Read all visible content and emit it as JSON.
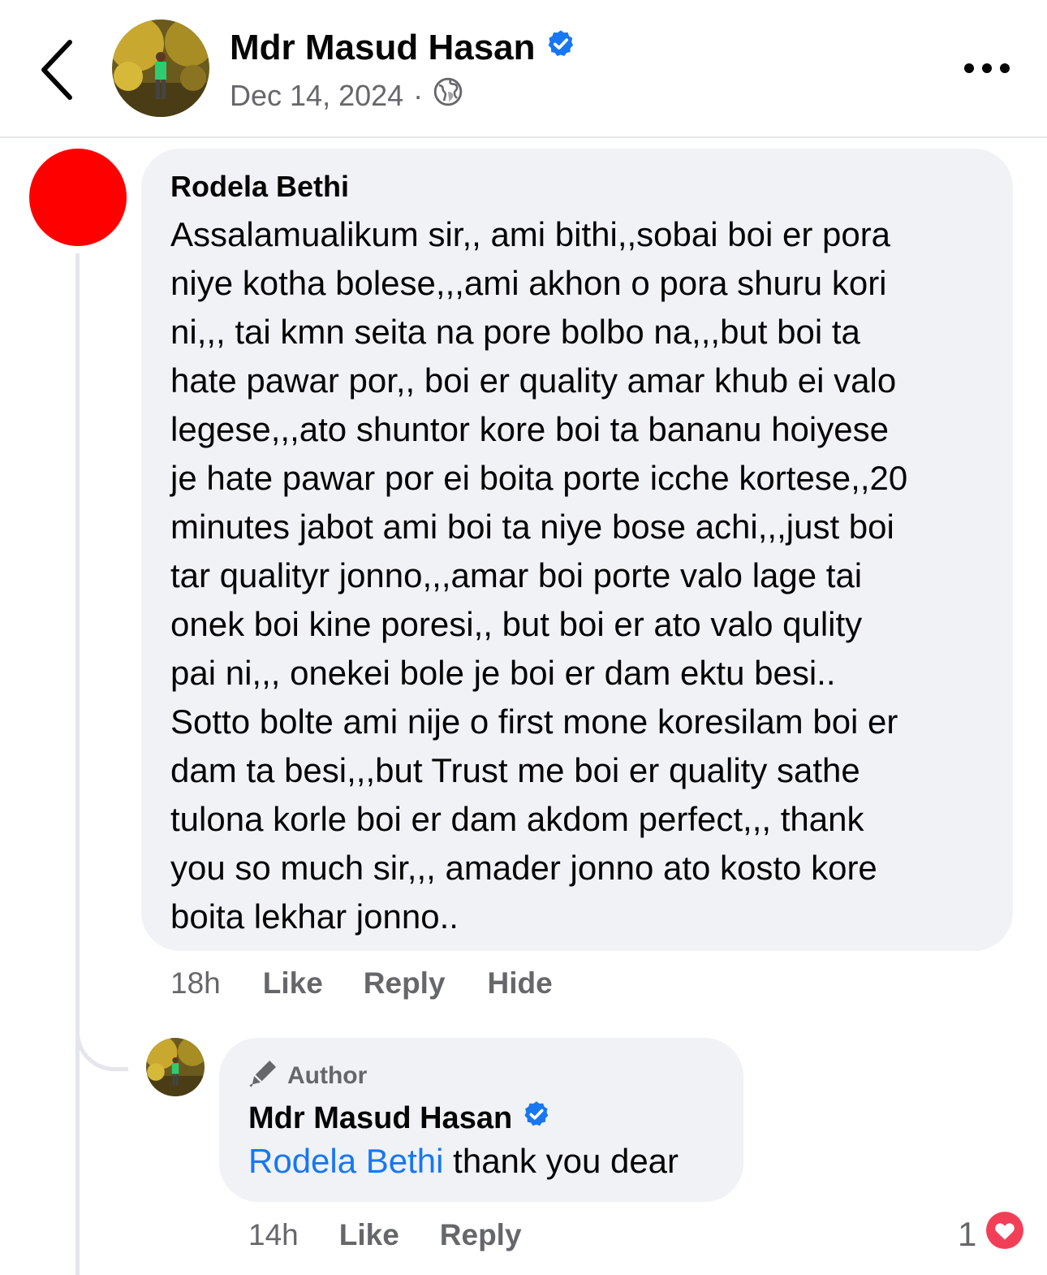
{
  "header": {
    "author_name": "Mdr Masud Hasan",
    "date": "Dec 14, 2024",
    "separator": "·",
    "audience_icon": "globe-icon",
    "back_icon": "chevron-left-icon",
    "more_icon": "more-horizontal-icon",
    "verified_icon": "verified-badge-icon"
  },
  "comment": {
    "author": "Rodela Bethi",
    "avatar_color": "#ff0000",
    "lines": [
      "Assalamualikum sir,, ami bithi,,sobai boi er pora",
      "niye kotha bolese,,,ami akhon o pora shuru kori",
      "ni,,, tai kmn seita na pore bolbo na,,,but boi ta",
      "hate pawar por,, boi er quality amar khub ei valo",
      "legese,,,ato shuntor kore boi ta bananu hoiyese",
      "je hate pawar por ei boita porte icche kortese,,20",
      "minutes jabot ami boi ta niye bose achi,,,just boi",
      "tar qualityr jonno,,,amar boi porte valo lage tai",
      "onek boi kine poresi,, but boi er ato valo qulity",
      "pai ni,,, onekei bole je boi er dam ektu besi..",
      "Sotto bolte ami nije o first mone koresilam boi er",
      "dam ta besi,,,but Trust me boi er quality sathe",
      "tulona korle boi er dam akdom perfect,,, thank",
      "you so much sir,,, amader jonno ato kosto kore",
      "boita lekhar jonno.."
    ],
    "time": "18h",
    "like_label": "Like",
    "reply_label": "Reply",
    "hide_label": "Hide"
  },
  "reply": {
    "badge_icon": "pencil-icon",
    "badge_label": "Author",
    "author": "Mdr Masud Hasan",
    "mention": "Rodela Bethi",
    "text": " thank you dear",
    "time": "14h",
    "like_label": "Like",
    "reply_label": "Reply",
    "reaction_count": "1",
    "reaction_icon": "love-reaction-icon"
  },
  "colors": {
    "accent": "#1877f2",
    "secondary_text": "#65676b",
    "bubble": "#f0f2f5",
    "heart": "#f33e58"
  }
}
